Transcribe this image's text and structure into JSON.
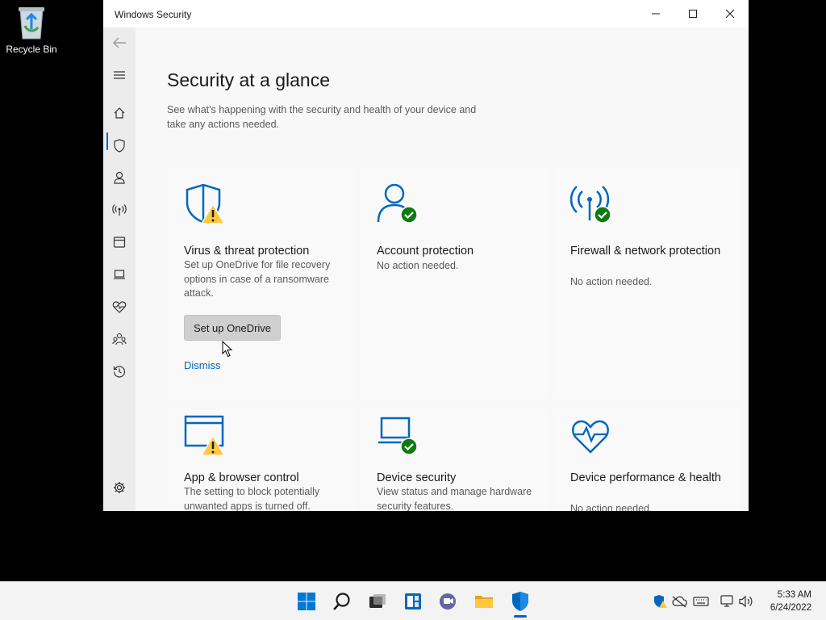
{
  "desktop": {
    "recycle_bin_label": "Recycle Bin"
  },
  "window": {
    "title": "Windows Security"
  },
  "page": {
    "title": "Security at a glance",
    "subtitle": "See what's happening with the security and health of your device and take any actions needed."
  },
  "cards": {
    "virus": {
      "title": "Virus & threat protection",
      "desc": "Set up OneDrive for file recovery options in case of a ransomware attack.",
      "button": "Set up OneDrive",
      "link": "Dismiss"
    },
    "account": {
      "title": "Account protection",
      "desc": "No action needed."
    },
    "firewall": {
      "title": "Firewall & network protection",
      "desc": "No action needed."
    },
    "appbrowser": {
      "title": "App & browser control",
      "desc": "The setting to block potentially unwanted apps is turned off."
    },
    "device": {
      "title": "Device security",
      "desc": "View status and manage hardware security features."
    },
    "performance": {
      "title": "Device performance & health",
      "desc": "No action needed."
    }
  },
  "taskbar": {
    "time": "5:33 AM",
    "date": "6/24/2022"
  },
  "colors": {
    "accent": "#0067c0",
    "warning": "#ffc83d",
    "ok": "#0f7b0f"
  }
}
